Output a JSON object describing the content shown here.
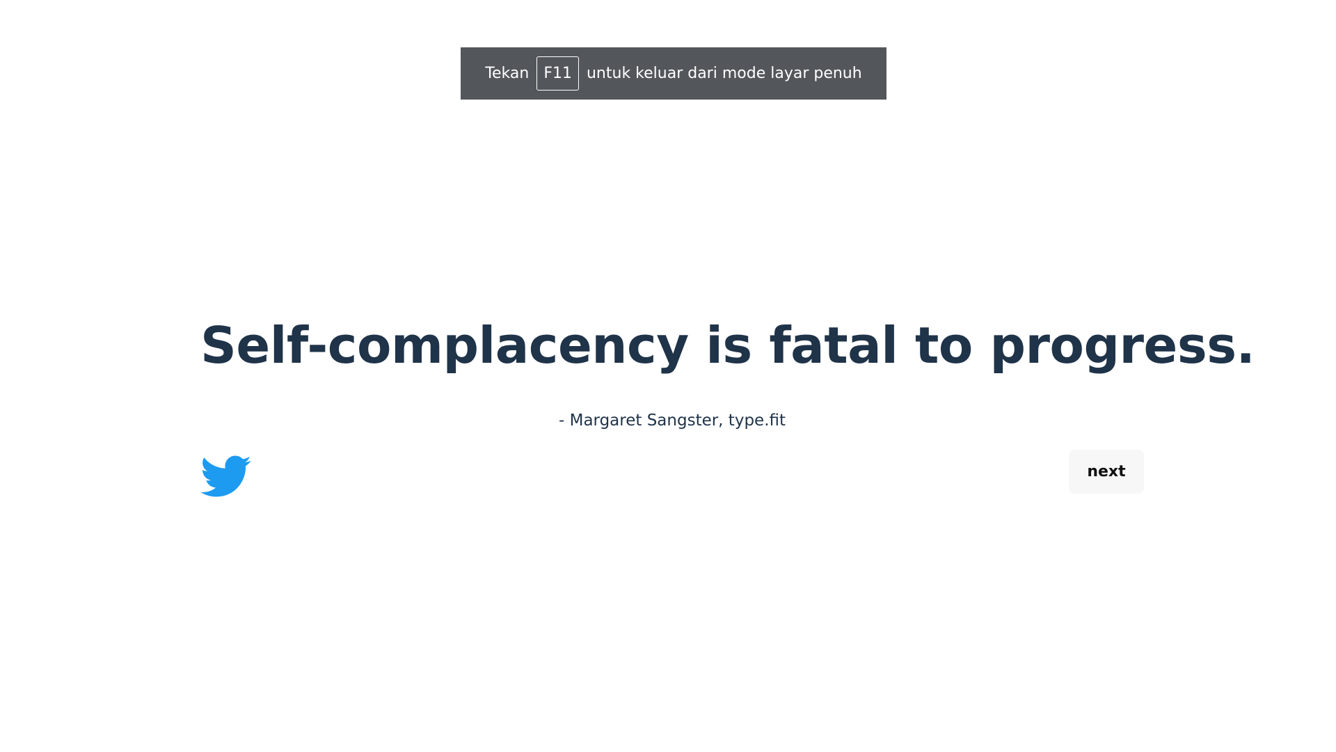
{
  "fullscreen_banner": {
    "prefix": "Tekan",
    "key": "F11",
    "suffix": "untuk keluar dari mode layar penuh"
  },
  "quote": {
    "text": "Self-complacency is fatal to progress.",
    "author": "- Margaret Sangster, type.fit"
  },
  "actions": {
    "share_icon": "twitter-bird-icon",
    "next_label": "next"
  },
  "colors": {
    "text": "#1f3349",
    "twitter": "#1d9bf0",
    "banner_bg": "#53575b",
    "button_bg": "#f7f7f7"
  }
}
